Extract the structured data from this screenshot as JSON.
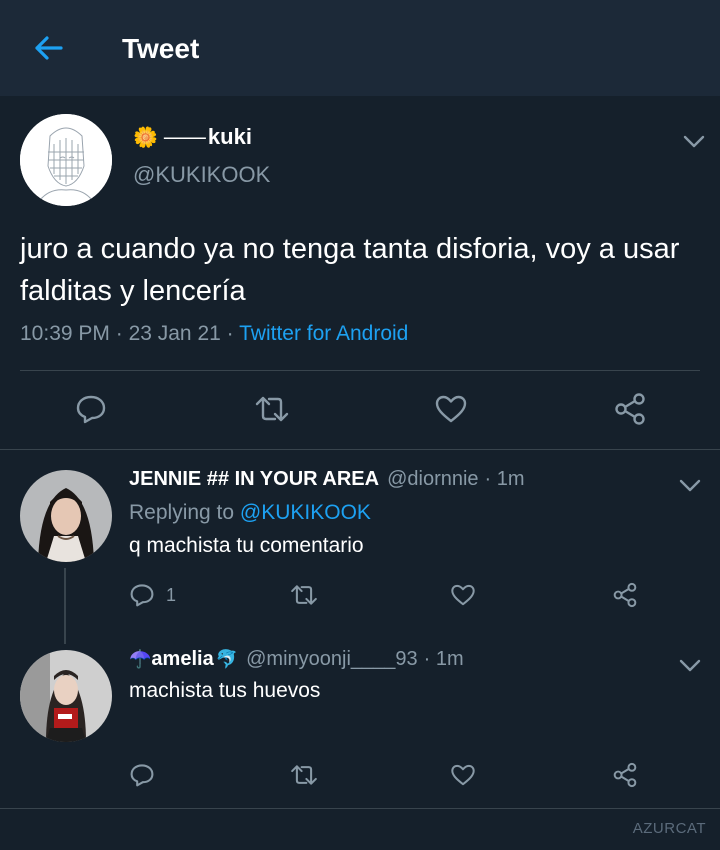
{
  "header": {
    "title": "Tweet",
    "back_icon": "arrow-left-icon"
  },
  "main_tweet": {
    "display_name_prefix_emoji": "🌼",
    "display_name_dash": "——",
    "display_name": "kuki",
    "handle": "@KUKIKOOK",
    "text": "juro a cuando ya no tenga tanta disforia, voy a usar falditas y lencería",
    "time": "10:39 PM",
    "date": "23 Jan 21",
    "source": "Twitter for Android",
    "separator": " · ",
    "actions": [
      "reply-icon",
      "retweet-icon",
      "like-icon",
      "share-icon"
    ]
  },
  "replies": [
    {
      "display_name": "JENNIE ## IN YOUR AREA",
      "handle": "@diornnie",
      "time": "· 1m",
      "replying_label": "Replying to",
      "replying_to": "@KUKIKOOK",
      "text": "q machista tu comentario",
      "reply_count": "1"
    },
    {
      "name_prefix_emoji": "☂️",
      "display_name": "amelia",
      "name_suffix_emoji": "🐬",
      "handle": "@minyoonji____93",
      "time": "· 1m",
      "text": "machista tus huevos"
    }
  ],
  "watermark": "AZURCAT",
  "colors": {
    "background": "#15202b",
    "header": "#1c2938",
    "accent": "#1da1f2",
    "muted": "#8899a6",
    "divider": "#38444d"
  }
}
